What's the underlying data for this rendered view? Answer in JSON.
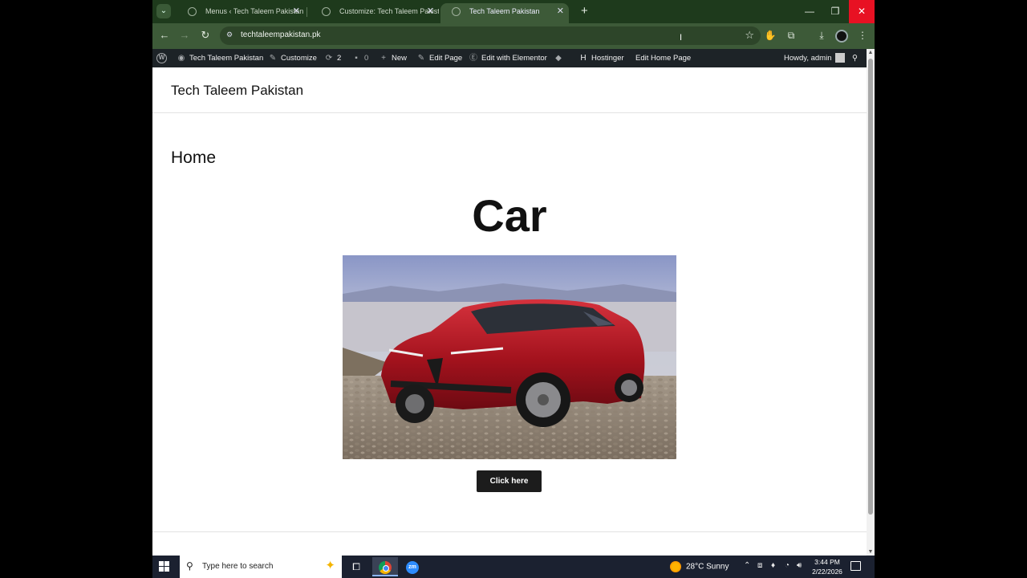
{
  "browser": {
    "tabs": [
      {
        "title": "Menus ‹ Tech Taleem Pakistan —",
        "active": false
      },
      {
        "title": "Customize: Tech Taleem Pakista",
        "active": false
      },
      {
        "title": "Tech Taleem Pakistan",
        "active": true
      }
    ],
    "url": "techtaleempakistan.pk"
  },
  "admin_bar": {
    "site_name": "Tech Taleem Pakistan",
    "customize": "Customize",
    "updates_count": "2",
    "comments_count": "0",
    "new": "New",
    "edit_page": "Edit Page",
    "edit_elementor": "Edit with Elementor",
    "hostinger": "Hostinger",
    "edit_home": "Edit Home Page",
    "howdy": "Howdy, admin"
  },
  "page": {
    "site_title": "Tech Taleem Pakistan",
    "page_title": "Home",
    "heading": "Car",
    "button_label": "Click here",
    "image_subject": "red-suv-on-rocky-shore"
  },
  "taskbar": {
    "search_placeholder": "Type here to search",
    "weather": "28°C  Sunny",
    "time": "3:44 PM",
    "date": "2/22/2026"
  }
}
